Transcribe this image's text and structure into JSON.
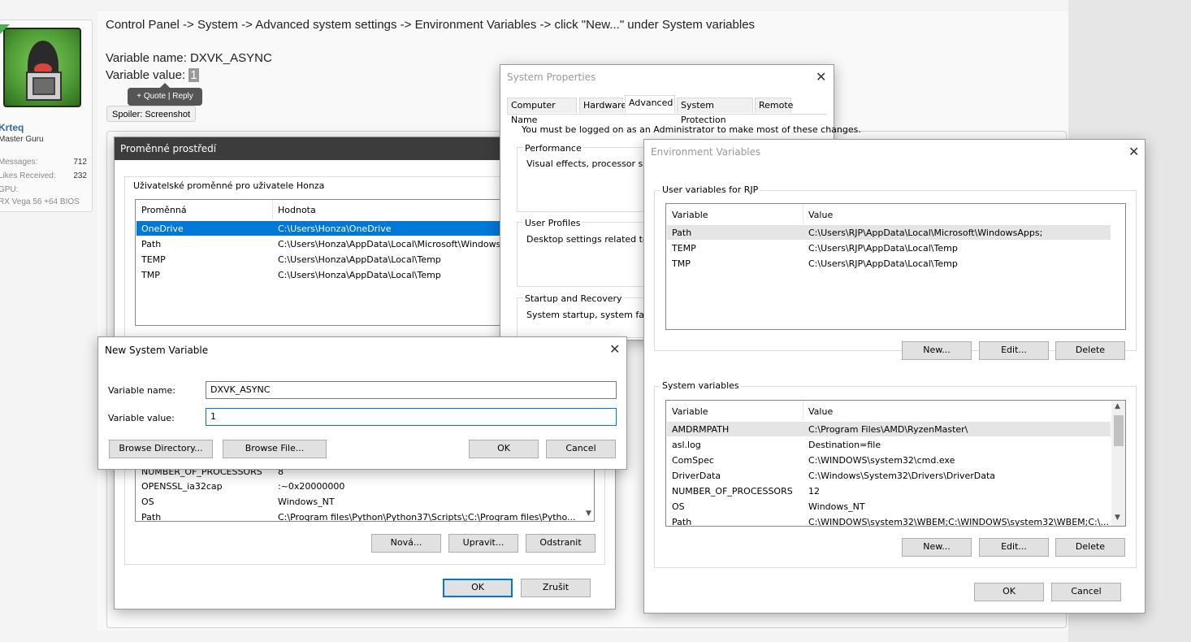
{
  "forum": {
    "instruction_path": "Control Panel -> System -> Advanced system settings -> Environment Variables -> click \"New...\" under System variables",
    "var_name_line": "Variable name: DXVK_ASYNC",
    "var_value_label": "Variable value: ",
    "var_value_value": "1",
    "tooltip": "+ Quote | Reply",
    "spoiler_label": "Spoiler: Screenshot",
    "user": {
      "name": "Krteq",
      "title": "Master Guru",
      "messages_label": "Messages:",
      "messages_value": "712",
      "likes_label": "Likes Received:",
      "likes_value": "232",
      "gpu_label": "GPU:",
      "gpu_value": "RX Vega 56 +64 BIOS"
    }
  },
  "czech_dialog": {
    "title": "Proměnné prostředí",
    "user_group": "Uživatelské proměnné pro uživatele Honza",
    "columns": [
      "Proměnná",
      "Hodnota"
    ],
    "user_rows": [
      {
        "name": "OneDrive",
        "value": "C:\\Users\\Honza\\OneDrive"
      },
      {
        "name": "Path",
        "value": "C:\\Users\\Honza\\AppData\\Local\\Microsoft\\Windows"
      },
      {
        "name": "TEMP",
        "value": "C:\\Users\\Honza\\AppData\\Local\\Temp"
      },
      {
        "name": "TMP",
        "value": "C:\\Users\\Honza\\AppData\\Local\\Temp"
      }
    ],
    "system_rows": [
      {
        "name": "NUMBER_OF_PROCESSORS",
        "value": "8"
      },
      {
        "name": "OPENSSL_ia32cap",
        "value": ":~0x20000000"
      },
      {
        "name": "OS",
        "value": "Windows_NT"
      },
      {
        "name": "Path",
        "value": "C:\\Program files\\Python\\Python37\\Scripts\\;C:\\Program files\\Pytho..."
      }
    ],
    "btn_new": "Nová...",
    "btn_edit": "Upravit...",
    "btn_delete": "Odstranit",
    "btn_ok": "OK",
    "btn_cancel": "Zrušit"
  },
  "system_properties": {
    "title": "System Properties",
    "tabs": [
      "Computer Name",
      "Hardware",
      "Advanced",
      "System Protection",
      "Remote"
    ],
    "admin_note": "You must be logged on as an Administrator to make most of these changes.",
    "performance_label": "Performance",
    "performance_text": "Visual effects, processor sched",
    "profiles_label": "User Profiles",
    "profiles_text": "Desktop settings related to you",
    "startup_label": "Startup and Recovery",
    "startup_text": "System startup, system failure, a"
  },
  "env_vars": {
    "title": "Environment Variables",
    "user_group": "User variables for RJP",
    "columns": [
      "Variable",
      "Value"
    ],
    "user_rows": [
      {
        "name": "Path",
        "value": "C:\\Users\\RJP\\AppData\\Local\\Microsoft\\WindowsApps;"
      },
      {
        "name": "TEMP",
        "value": "C:\\Users\\RJP\\AppData\\Local\\Temp"
      },
      {
        "name": "TMP",
        "value": "C:\\Users\\RJP\\AppData\\Local\\Temp"
      }
    ],
    "system_group": "System variables",
    "system_rows": [
      {
        "name": "AMDRMPATH",
        "value": "C:\\Program Files\\AMD\\RyzenMaster\\"
      },
      {
        "name": "asl.log",
        "value": "Destination=file"
      },
      {
        "name": "ComSpec",
        "value": "C:\\WINDOWS\\system32\\cmd.exe"
      },
      {
        "name": "DriverData",
        "value": "C:\\Windows\\System32\\Drivers\\DriverData"
      },
      {
        "name": "NUMBER_OF_PROCESSORS",
        "value": "12"
      },
      {
        "name": "OS",
        "value": "Windows_NT"
      },
      {
        "name": "Path",
        "value": "C:\\WINDOWS\\system32\\WBEM;C:\\WINDOWS\\system32\\WBEM;C:\\..."
      }
    ],
    "btn_new": "New...",
    "btn_edit": "Edit...",
    "btn_delete": "Delete",
    "btn_ok": "OK",
    "btn_cancel": "Cancel"
  },
  "new_var": {
    "title": "New System Variable",
    "name_label": "Variable name:",
    "name_value": "DXVK_ASYNC",
    "value_label": "Variable value:",
    "value_value": "1",
    "btn_browse_dir": "Browse Directory...",
    "btn_browse_file": "Browse File...",
    "btn_ok": "OK",
    "btn_cancel": "Cancel"
  },
  "colors": {
    "selection": "#0078d7",
    "link": "#2d6aa6"
  }
}
